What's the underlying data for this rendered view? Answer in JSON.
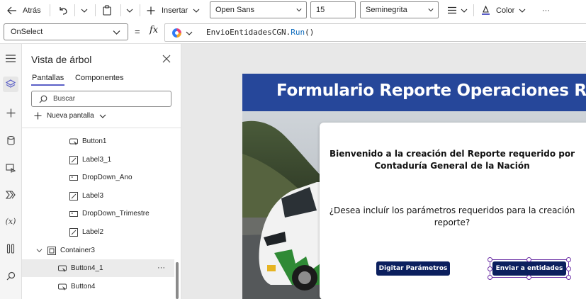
{
  "toolbar": {
    "back_label": "Atrás",
    "insert_label": "Insertar",
    "font_family": "Open Sans",
    "font_size": "15",
    "font_weight": "Seminegrita",
    "color_label": "Color",
    "more_label": "···"
  },
  "formula": {
    "property": "OnSelect",
    "fx_label": "fx",
    "equals_label": "=",
    "expression_name": "EnvioEntidadesCGN.",
    "expression_fn": "Run",
    "expression_args": "()"
  },
  "tree": {
    "title": "Vista de árbol",
    "tabs": [
      "Pantallas",
      "Componentes"
    ],
    "active_tab": "Pantallas",
    "search_placeholder": "Buscar",
    "new_screen_label": "Nueva pantalla",
    "items": [
      {
        "label": "Button1",
        "icon": "button-icon"
      },
      {
        "label": "Label3_1",
        "icon": "label-icon"
      },
      {
        "label": "DropDown_Ano",
        "icon": "dropdown-icon"
      },
      {
        "label": "Label3",
        "icon": "label-icon"
      },
      {
        "label": "DropDown_Trimestre",
        "icon": "dropdown-icon"
      },
      {
        "label": "Label2",
        "icon": "label-icon"
      },
      {
        "label": "Container3",
        "icon": "container-icon"
      },
      {
        "label": "Button4_1",
        "icon": "button-icon"
      },
      {
        "label": "Button4",
        "icon": "button-icon"
      }
    ],
    "selected_item": "Button4_1",
    "row_more_label": "···"
  },
  "app": {
    "header_title": "Formulario Reporte Operaciones R",
    "welcome_line1": "Bienvenido a la creación del Reporte requerido por",
    "welcome_line2": "Contaduría General de la Nación",
    "question_line1": "¿Desea incluír los parámetros requeridos para la creación",
    "question_line2": "reporte?",
    "btn_params": "Digitar Parámetros",
    "btn_send": "Enviar a entidades"
  },
  "colors": {
    "header_bg": "#26479a",
    "button_bg": "#0b1f5e",
    "accent": "#5b5fc7",
    "selection": "#6b2fa5"
  }
}
